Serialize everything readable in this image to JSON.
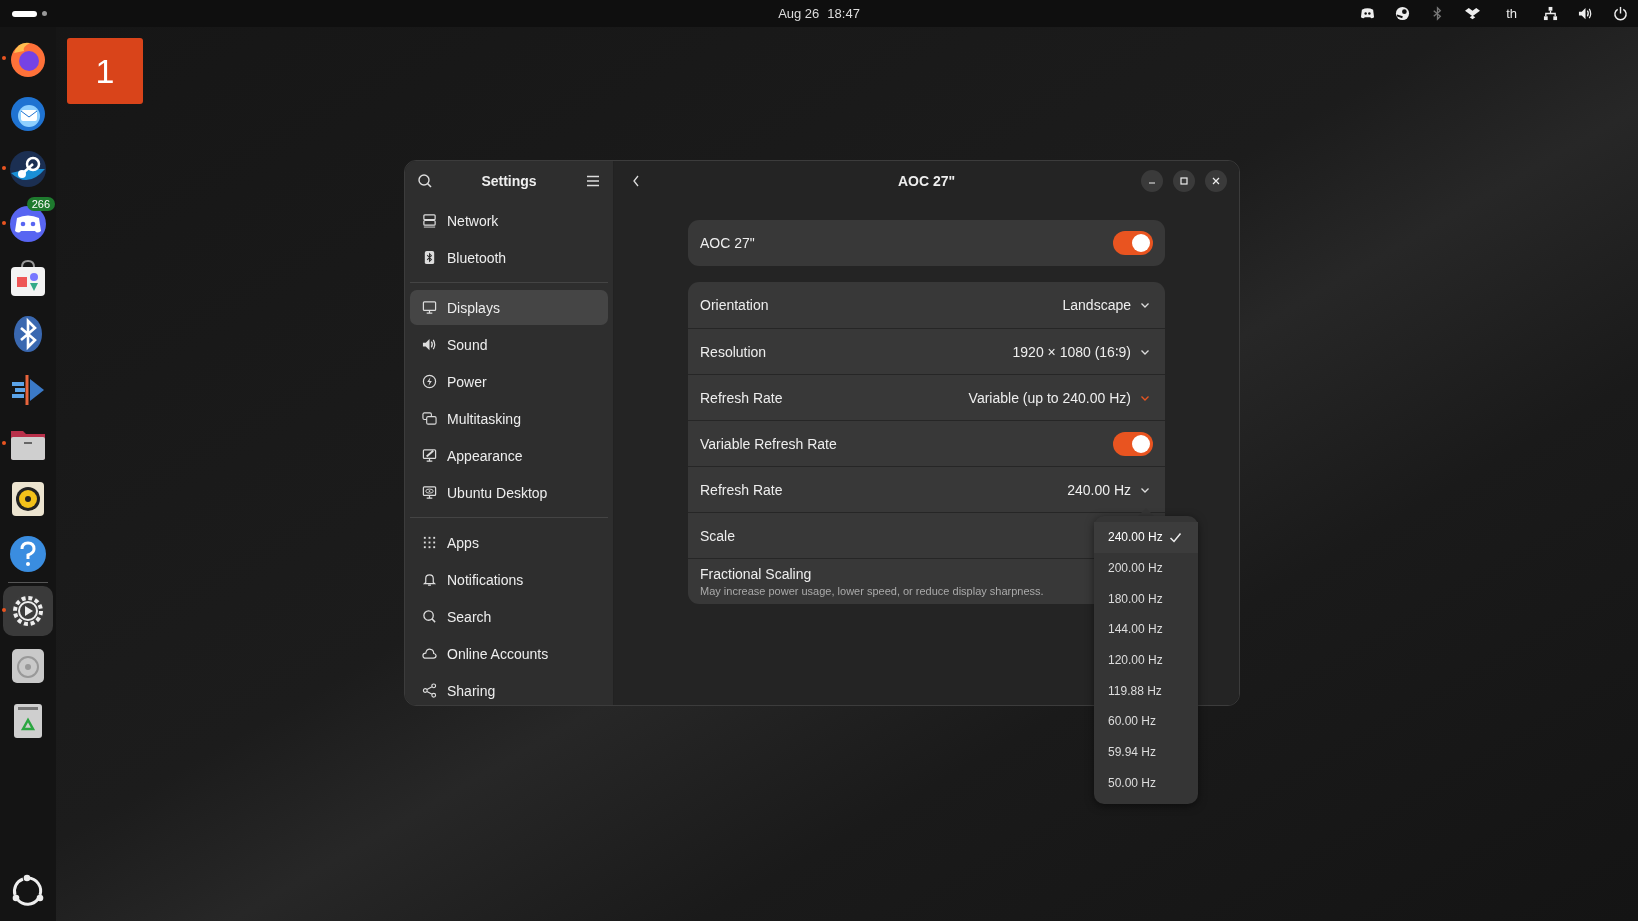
{
  "top_bar": {
    "date": "Aug 26",
    "time": "18:47",
    "tray": [
      {
        "kind": "chat"
      },
      {
        "kind": "game"
      },
      {
        "kind": "bluetooth"
      },
      {
        "kind": "dropbox"
      },
      {
        "kind": "layout",
        "label": "th"
      },
      {
        "kind": "network"
      },
      {
        "kind": "volume"
      },
      {
        "kind": "power"
      }
    ]
  },
  "dock": {
    "apps": [
      {
        "kind": "browser",
        "running": true,
        "active": false
      },
      {
        "kind": "mail",
        "running": false,
        "active": false
      },
      {
        "kind": "game",
        "running": true,
        "active": false
      },
      {
        "kind": "chat",
        "running": true,
        "active": false,
        "badge": "266"
      },
      {
        "kind": "store",
        "running": false,
        "active": false
      },
      {
        "kind": "bluetooth",
        "running": false,
        "active": false
      },
      {
        "kind": "media",
        "running": false,
        "active": false
      },
      {
        "kind": "files",
        "running": true,
        "active": false
      },
      {
        "kind": "audio",
        "running": false,
        "active": false
      },
      {
        "kind": "help",
        "running": false,
        "active": false
      },
      {
        "kind": "settings",
        "running": true,
        "active": true
      },
      {
        "kind": "disc",
        "running": false,
        "active": false
      },
      {
        "kind": "trash",
        "running": false,
        "active": false
      }
    ]
  },
  "workspace": {
    "number": "1"
  },
  "settings_window": {
    "sidebar": {
      "title": "Settings",
      "groups": [
        {
          "items": [
            {
              "label": "Network",
              "kind": "network",
              "selected": false
            },
            {
              "label": "Bluetooth",
              "kind": "bluetooth",
              "selected": false
            }
          ]
        },
        {
          "items": [
            {
              "label": "Displays",
              "kind": "display",
              "selected": true
            },
            {
              "label": "Sound",
              "kind": "sound",
              "selected": false
            },
            {
              "label": "Power",
              "kind": "power",
              "selected": false
            },
            {
              "label": "Multitasking",
              "kind": "multitasking",
              "selected": false
            },
            {
              "label": "Appearance",
              "kind": "appearance",
              "selected": false
            },
            {
              "label": "Ubuntu Desktop",
              "kind": "desktop",
              "selected": false
            }
          ]
        },
        {
          "items": [
            {
              "label": "Apps",
              "kind": "apps",
              "selected": false
            },
            {
              "label": "Notifications",
              "kind": "bell",
              "selected": false
            },
            {
              "label": "Search",
              "kind": "search",
              "selected": false
            },
            {
              "label": "Online Accounts",
              "kind": "cloud",
              "selected": false
            },
            {
              "label": "Sharing",
              "kind": "share",
              "selected": false
            }
          ]
        }
      ]
    },
    "page": {
      "title": "AOC 27\"",
      "display": {
        "label": "AOC 27\"",
        "on": true
      },
      "rows": [
        {
          "kind": "dropdown",
          "label": "Orientation",
          "value": "Landscape",
          "highlighted": false
        },
        {
          "kind": "dropdown",
          "label": "Resolution",
          "value": "1920 × 1080 (16∶9)",
          "highlighted": false
        },
        {
          "kind": "dropdown",
          "label": "Refresh Rate",
          "value": "Variable (up to 240.00 Hz)",
          "highlighted": true
        },
        {
          "kind": "toggle",
          "label": "Variable Refresh Rate",
          "on": true
        },
        {
          "kind": "dropdown",
          "label": "Refresh Rate",
          "value": "240.00 Hz",
          "highlighted": false
        },
        {
          "kind": "plain",
          "label": "Scale"
        },
        {
          "kind": "described",
          "label": "Fractional Scaling",
          "description": "May increase power usage, lower speed, or reduce display sharpness."
        }
      ]
    }
  },
  "refresh_rate_menu": {
    "options": [
      {
        "label": "240.00 Hz",
        "selected": true
      },
      {
        "label": "200.00 Hz",
        "selected": false
      },
      {
        "label": "180.00 Hz",
        "selected": false
      },
      {
        "label": "144.00 Hz",
        "selected": false
      },
      {
        "label": "120.00 Hz",
        "selected": false
      },
      {
        "label": "119.88 Hz",
        "selected": false
      },
      {
        "label": "60.00 Hz",
        "selected": false
      },
      {
        "label": "59.94 Hz",
        "selected": false
      },
      {
        "label": "50.00 Hz",
        "selected": false
      }
    ]
  }
}
